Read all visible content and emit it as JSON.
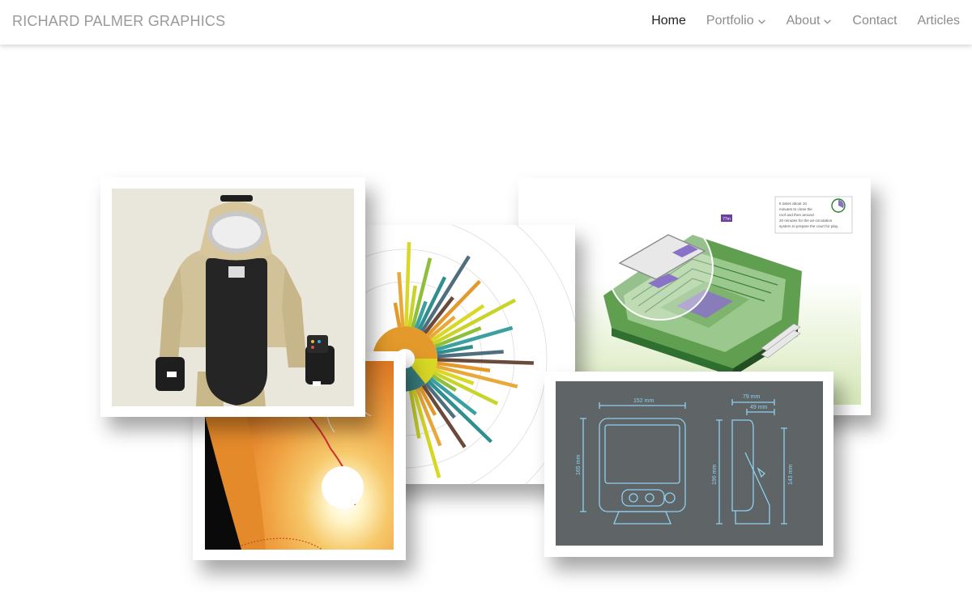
{
  "header": {
    "brand": "RICHARD PALMER GRAPHICS",
    "nav": [
      {
        "label": "Home",
        "active": true,
        "dropdown": false
      },
      {
        "label": "Portfolio",
        "active": false,
        "dropdown": true
      },
      {
        "label": "About",
        "active": false,
        "dropdown": true
      },
      {
        "label": "Contact",
        "active": false,
        "dropdown": false
      },
      {
        "label": "Articles",
        "active": false,
        "dropdown": false
      }
    ]
  },
  "collage": {
    "stadium_note": [
      "It takes about 10",
      "minutes to close the",
      "roof and then around",
      "20 minutes for the air-circulation",
      "system to prepare the court for play."
    ],
    "stadium_tag": "77m",
    "device_dims": {
      "width": "152 mm",
      "height": "165 mm",
      "depth_outer": "79 mm",
      "depth_inner": "49 mm",
      "side_height": "196 mm",
      "side_height_inner": "143 mm"
    }
  },
  "colors": {
    "brand_text": "#9a9a9a",
    "nav_text": "#8c8c8c",
    "nav_active": "#222222",
    "device_bg": "#5f6466",
    "device_line": "#8fd0f0"
  }
}
